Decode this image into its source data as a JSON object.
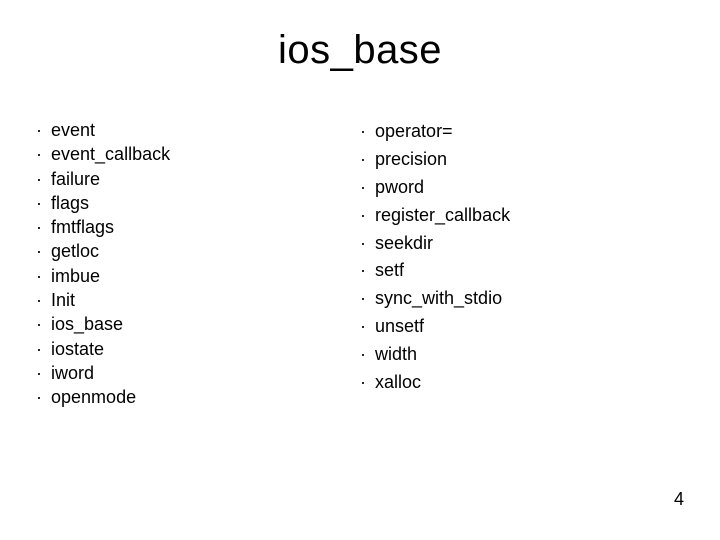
{
  "title": "ios_base",
  "bullet": "·",
  "columns": {
    "left": [
      "event",
      "event_callback",
      "failure",
      "flags",
      "fmtflags",
      "getloc",
      "imbue",
      "Init",
      "ios_base",
      "iostate",
      "iword",
      "openmode"
    ],
    "right": [
      "operator=",
      "precision",
      "pword",
      "register_callback",
      "seekdir",
      "setf",
      "sync_with_stdio",
      "unsetf",
      "width",
      "xalloc"
    ]
  },
  "page_number": "4"
}
